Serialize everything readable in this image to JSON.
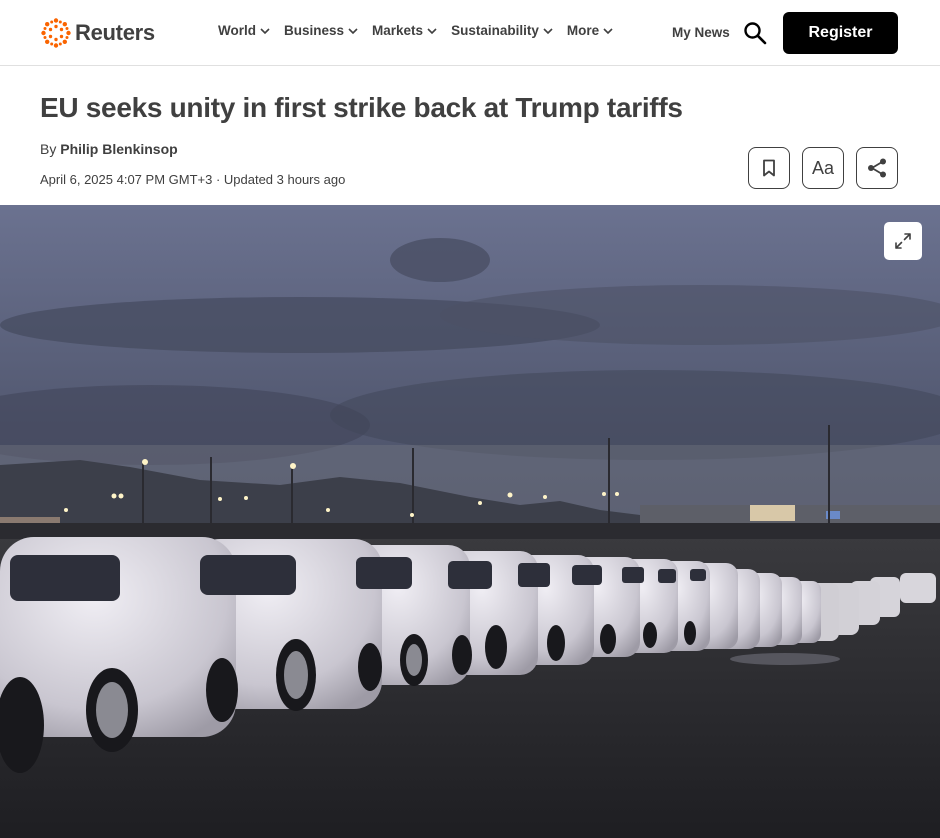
{
  "header": {
    "brand": "Reuters",
    "nav": [
      {
        "label": "World"
      },
      {
        "label": "Business"
      },
      {
        "label": "Markets"
      },
      {
        "label": "Sustainability"
      },
      {
        "label": "More"
      }
    ],
    "my_news": "My News",
    "register_label": "Register",
    "brand_color": "#fa6400"
  },
  "article": {
    "headline": "EU seeks unity in first strike back at Trump tariffs",
    "by_prefix": "By",
    "author": "Philip Blenkinsop",
    "dateline": "April 6, 2025 4:07 PM GMT+3 · Updated 3 hours ago",
    "font_size_label": "Aa",
    "tools": [
      "bookmark-icon",
      "font-size-icon",
      "share-icon"
    ]
  },
  "photo": {
    "description_icon": "expand-icon"
  }
}
